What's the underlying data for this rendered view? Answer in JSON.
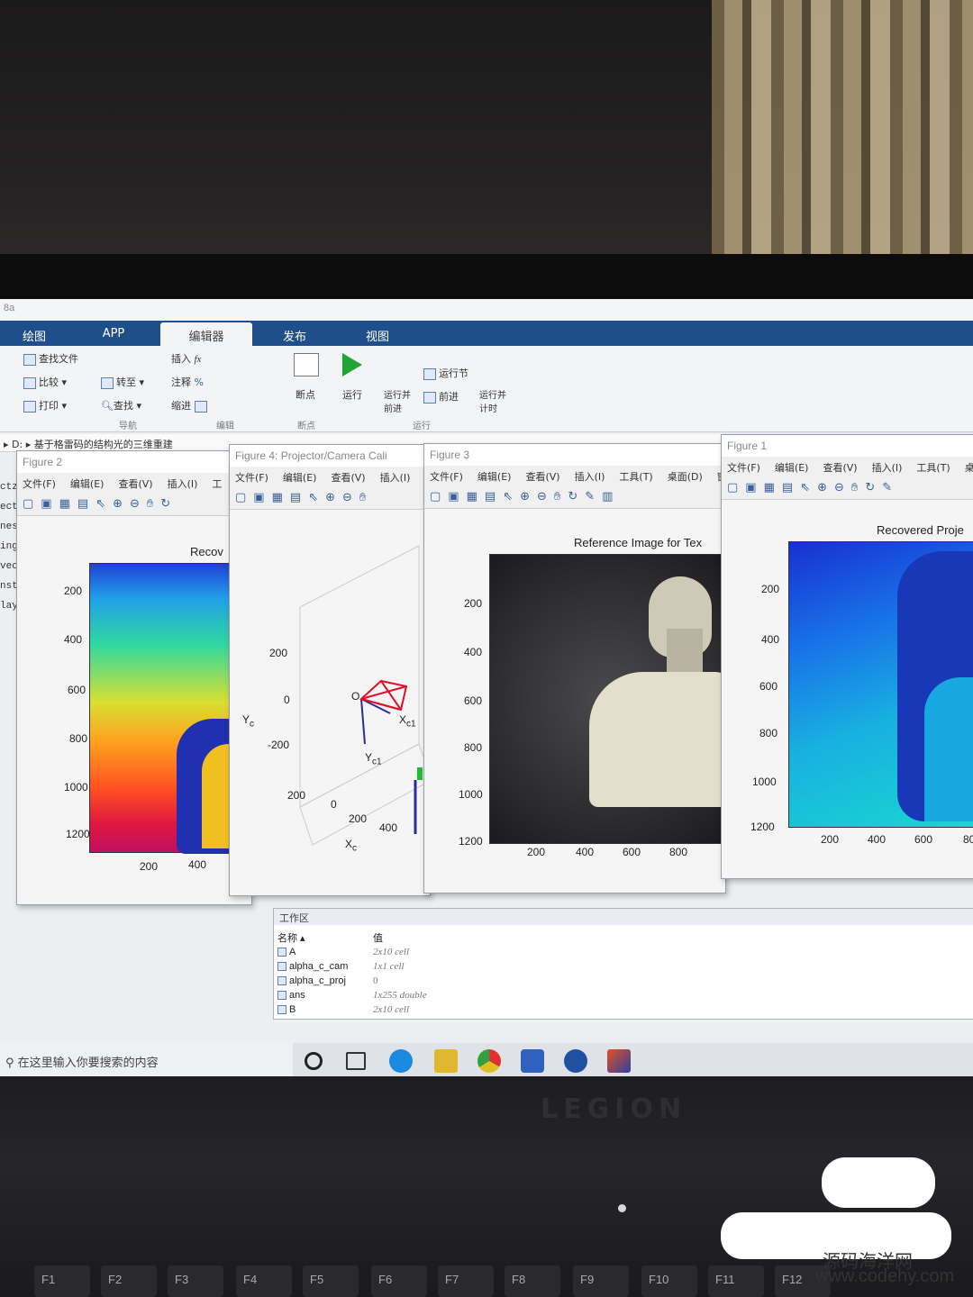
{
  "window": {
    "title": "8a"
  },
  "tabs": [
    "绘图",
    "APP",
    "编辑器",
    "发布",
    "视图"
  ],
  "ribbon": {
    "file_items": [
      "查找文件",
      "比较",
      "打印"
    ],
    "nav_items": [
      "转至",
      "查找"
    ],
    "edit_items": [
      "插入",
      "注释",
      "缩进"
    ],
    "breakpoint_label": "断点",
    "run_label": "运行",
    "run_advance_label": "运行并前进",
    "run_section_label": "运行节",
    "advance_label": "前进",
    "run_time_label": "运行并计时",
    "sections": [
      "导航",
      "编辑",
      "断点",
      "运行"
    ]
  },
  "pathbar": {
    "path": "▸ D: ▸ 基于格雷码的结构光的三维重建"
  },
  "sidebar_fragments": [
    "ctz",
    "ect",
    "nes",
    "ing",
    "vec",
    "nst",
    "lay"
  ],
  "figures": {
    "fig2": {
      "title": "Figure 2",
      "menu": [
        "文件(F)",
        "编辑(E)",
        "查看(V)",
        "插入(I)",
        "工"
      ],
      "plot_title": "Recov",
      "yticks": [
        "200",
        "400",
        "600",
        "800",
        "1000",
        "1200"
      ],
      "xticks": [
        "200",
        "400"
      ]
    },
    "fig4": {
      "title": "Figure 4: Projector/Camera Cali",
      "menu": [
        "文件(F)",
        "编辑(E)",
        "查看(V)",
        "插入(I)"
      ],
      "yticks": [
        "200",
        "0",
        "-200"
      ],
      "zticks": [
        "200",
        "0",
        "200",
        "400"
      ],
      "ylabel": "Y",
      "ylabel_sub": "c",
      "xlabel": "X",
      "xlabel_sub": "c",
      "origin_label": "O",
      "xc1_label": "X",
      "xc1_sub": "c1",
      "yc1_label": "Y",
      "yc1_sub": "c1"
    },
    "fig3": {
      "title": "Figure 3",
      "menu": [
        "文件(F)",
        "编辑(E)",
        "查看(V)",
        "插入(I)",
        "工具(T)",
        "桌面(D)",
        "窗"
      ],
      "plot_title": "Reference Image for Tex",
      "yticks": [
        "200",
        "400",
        "600",
        "800",
        "1000",
        "1200"
      ],
      "xticks": [
        "200",
        "400",
        "600",
        "800"
      ]
    },
    "fig1": {
      "title": "Figure 1",
      "menu": [
        "文件(F)",
        "编辑(E)",
        "查看(V)",
        "插入(I)",
        "工具(T)",
        "桌"
      ],
      "plot_title": "Recovered Proje",
      "yticks": [
        "200",
        "400",
        "600",
        "800",
        "1000",
        "1200"
      ],
      "xticks": [
        "200",
        "400",
        "600",
        "80"
      ]
    }
  },
  "workspace": {
    "title": "工作区",
    "col_name": "名称 ▴",
    "col_value": "值",
    "rows": [
      {
        "name": "A",
        "value": "2x10 cell"
      },
      {
        "name": "alpha_c_cam",
        "value": "1x1 cell"
      },
      {
        "name": "alpha_c_proj",
        "value": "0"
      },
      {
        "name": "ans",
        "value": "1x255 double"
      },
      {
        "name": "B",
        "value": "2x10 cell"
      }
    ]
  },
  "taskbar": {
    "search_placeholder": "在这里输入你要搜索的内容"
  },
  "laptop": {
    "brand": "LEGION",
    "keys": [
      "F1",
      "F2",
      "F3",
      "F4",
      "F5",
      "F6",
      "F7",
      "F8",
      "F9",
      "F10",
      "F11",
      "F12"
    ]
  },
  "watermark": {
    "line1": "源码海洋网",
    "line2": "www.codehy.com"
  },
  "colors": {
    "matlab_blue": "#1f4f8a",
    "run_green": "#21a336",
    "pose_red": "#e0102a"
  }
}
